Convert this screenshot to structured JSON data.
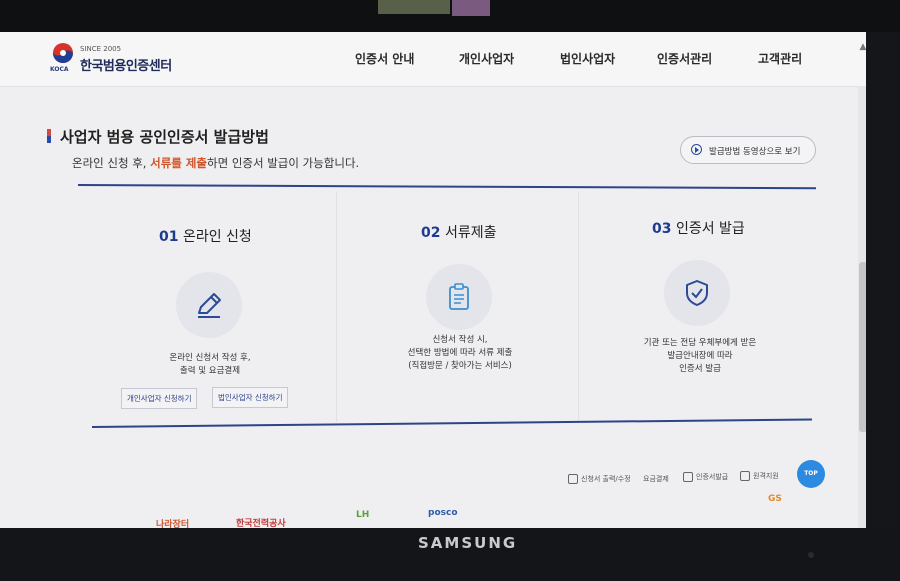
{
  "header": {
    "logo_since": "SINCE 2005",
    "logo_sub": "KOCA",
    "logo_name": "한국범용인증센터",
    "nav": [
      "인증서 안내",
      "개인사업자",
      "법인사업자",
      "인증서관리",
      "고객관리"
    ]
  },
  "section": {
    "title": "사업자 범용 공인인증서 발급방법",
    "desc_before": "온라인 신청 후, ",
    "desc_highlight": "서류를 제출",
    "desc_after": "하면 인증서 발급이 가능합니다.",
    "video_button": "발급방법 동영상으로 보기"
  },
  "steps": [
    {
      "num": "01",
      "title": "온라인 신청",
      "icon": "pencil-icon",
      "desc": [
        "온라인 신청서 작성 후,",
        "출력 및 요금결제"
      ],
      "buttons": [
        "개인사업자 신청하기",
        "법인사업자 신청하기"
      ]
    },
    {
      "num": "02",
      "title": "서류제출",
      "icon": "clipboard-icon",
      "desc": [
        "신청서 작성 시,",
        "선택한 방법에 따라 서류 제출",
        "(직접방문 / 찾아가는 서비스)"
      ]
    },
    {
      "num": "03",
      "title": "인증서 발급",
      "icon": "shield-check-icon",
      "desc": [
        "기관 또는 전담 우체부에게 받은",
        "발급안내장에 따라",
        "인증서 발급"
      ]
    }
  ],
  "quick_links": [
    "신청서 출력/수정",
    "요금결제",
    "인증서발급",
    "원격지원"
  ],
  "top_button": "TOP",
  "partners": [
    "나라장터",
    "한국전력공사",
    "LH",
    "posco",
    "GS"
  ],
  "device_brand": "SAMSUNG",
  "colors": {
    "accent_blue": "#1d3c8f",
    "highlight_orange": "#d0552b",
    "top_button": "#2c8be0"
  }
}
